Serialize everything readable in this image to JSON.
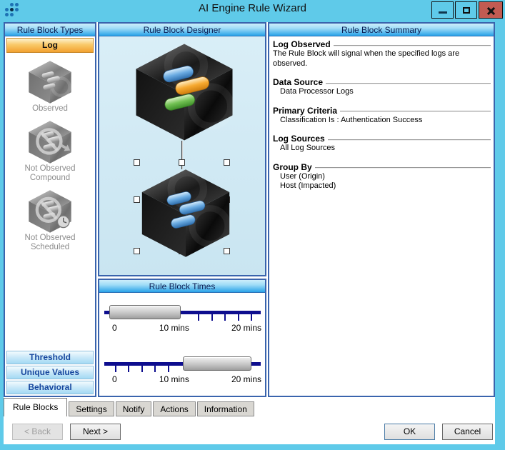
{
  "window": {
    "title": "AI Engine Rule Wizard"
  },
  "left_panel": {
    "header": "Rule Block Types",
    "selected_type": "Log",
    "items": [
      {
        "name": "observed",
        "label_lines": [
          "Observed"
        ]
      },
      {
        "name": "not-observed-compound",
        "label_lines": [
          "Not Observed",
          "Compound"
        ]
      },
      {
        "name": "not-observed-scheduled",
        "label_lines": [
          "Not Observed",
          "Scheduled"
        ]
      }
    ],
    "type_buttons": [
      "Threshold",
      "Unique Values",
      "Behavioral"
    ]
  },
  "designer": {
    "header": "Rule Block Designer"
  },
  "times": {
    "header": "Rule Block Times",
    "sliders": [
      {
        "labels": [
          "0",
          "10 mins",
          "20 mins"
        ],
        "selected_range_mins": [
          0,
          10
        ]
      },
      {
        "labels": [
          "0",
          "10 mins",
          "20 mins"
        ],
        "selected_range_mins": [
          10,
          20
        ]
      }
    ]
  },
  "summary": {
    "header": "Rule Block Summary",
    "sections": [
      {
        "title": "Log Observed",
        "lines": [
          "The Rule Block will signal when the specified logs are observed."
        ]
      },
      {
        "title": "Data Source",
        "lines": [
          "Data Processor Logs"
        ]
      },
      {
        "title": "Primary Criteria",
        "lines": [
          "Classification Is : Authentication Success"
        ]
      },
      {
        "title": "Log Sources",
        "lines": [
          "All Log Sources"
        ]
      },
      {
        "title": "Group By",
        "lines": [
          "User (Origin)",
          "Host (Impacted)"
        ]
      }
    ]
  },
  "tabs": [
    {
      "label": "Rule Blocks",
      "active": true
    },
    {
      "label": "Settings",
      "active": false
    },
    {
      "label": "Notify",
      "active": false
    },
    {
      "label": "Actions",
      "active": false
    },
    {
      "label": "Information",
      "active": false
    }
  ],
  "footer": {
    "back": "< Back",
    "next": "Next >",
    "ok": "OK",
    "cancel": "Cancel"
  },
  "icons": [
    "app-logo-dots-icon",
    "minimize-icon",
    "maximize-icon",
    "close-icon",
    "log-cube-observed-icon",
    "log-cube-not-observed-compound-icon",
    "log-cube-not-observed-scheduled-icon",
    "rule-block-cube-icon"
  ],
  "colors": {
    "titlebar": "#5fcae9",
    "close_button": "#c25b52",
    "panel_header_top": "#cdeefb",
    "panel_header_bottom": "#28a2e8",
    "panel_border": "#3a64ad",
    "selected_type_orange": "#f2a12f",
    "type_button_text": "#17479e",
    "slider_track": "#0d0d8e",
    "pill_blue": "#6aabe2",
    "pill_orange": "#f6a930",
    "pill_green": "#72c153"
  }
}
